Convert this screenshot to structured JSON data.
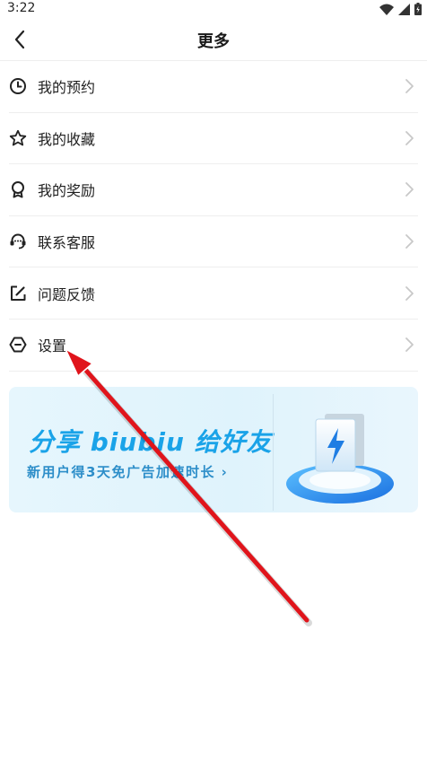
{
  "status_bar": {
    "time": "3:22"
  },
  "header": {
    "title": "更多"
  },
  "menu": {
    "items": [
      {
        "label": "我的预约",
        "icon": "clock-icon"
      },
      {
        "label": "我的收藏",
        "icon": "star-icon"
      },
      {
        "label": "我的奖励",
        "icon": "award-icon"
      },
      {
        "label": "联系客服",
        "icon": "headset-icon"
      },
      {
        "label": "问题反馈",
        "icon": "edit-icon"
      },
      {
        "label": "设置",
        "icon": "settings-icon"
      }
    ]
  },
  "banner": {
    "title": "分享 biubiu 给好友",
    "subtitle": "新用户得3天免广告加速时长 ›"
  },
  "colors": {
    "accent": "#1aa3e8",
    "annotation_arrow": "#e0141b"
  }
}
